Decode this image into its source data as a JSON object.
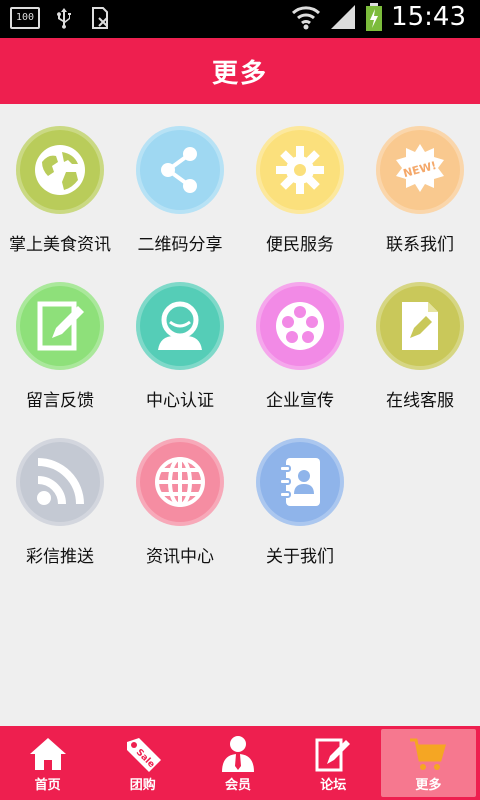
{
  "status_bar": {
    "battery_small": "100",
    "time": "15:43"
  },
  "header": {
    "title": "更多"
  },
  "grid": [
    {
      "label": "掌上美食资讯",
      "color": "#b9cc5a",
      "icon": "globe-icon"
    },
    {
      "label": "二维码分享",
      "color": "#9fd8f2",
      "icon": "share-icon"
    },
    {
      "label": "便民服务",
      "color": "#fbe07c",
      "icon": "gear-icon"
    },
    {
      "label": "联系我们",
      "color": "#f9c98f",
      "icon": "new-badge-icon"
    },
    {
      "label": "留言反馈",
      "color": "#8ee07a",
      "icon": "edit-icon"
    },
    {
      "label": "中心认证",
      "color": "#55cdb7",
      "icon": "user-icon"
    },
    {
      "label": "企业宣传",
      "color": "#f28ae6",
      "icon": "film-reel-icon"
    },
    {
      "label": "在线客服",
      "color": "#c9c85a",
      "icon": "document-pen-icon"
    },
    {
      "label": "彩信推送",
      "color": "#c4c9d3",
      "icon": "rss-icon"
    },
    {
      "label": "资讯中心",
      "color": "#f58da2",
      "icon": "web-globe-icon"
    },
    {
      "label": "关于我们",
      "color": "#8fb4ea",
      "icon": "contacts-book-icon"
    }
  ],
  "tabbar": [
    {
      "label": "首页",
      "icon": "home-icon"
    },
    {
      "label": "团购",
      "icon": "sale-tag-icon"
    },
    {
      "label": "会员",
      "icon": "member-icon"
    },
    {
      "label": "论坛",
      "icon": "forum-edit-icon"
    },
    {
      "label": "更多",
      "icon": "cart-icon"
    }
  ]
}
